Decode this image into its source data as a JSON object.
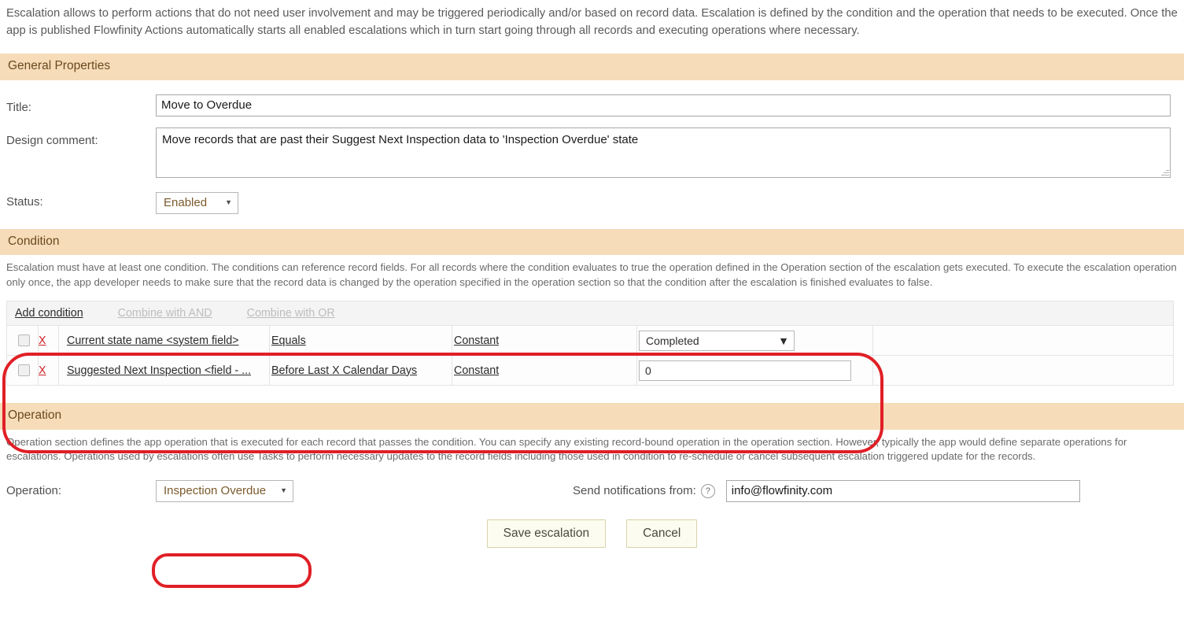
{
  "intro": {
    "text": "Escalation allows to perform actions that do not need user involvement and may be triggered periodically and/or based on record data. Escalation is defined by the condition and the operation that needs to be executed. Once the app is published Flowfinity Actions automatically starts all enabled escalations which in turn start going through all records and executing operations where necessary."
  },
  "general": {
    "header": "General Properties",
    "title_label": "Title:",
    "title_value": "Move to Overdue",
    "comment_label": "Design comment:",
    "comment_value": "Move records that are past their Suggest Next Inspection data to 'Inspection Overdue' state",
    "status_label": "Status:",
    "status_value": "Enabled"
  },
  "condition": {
    "header": "Condition",
    "description": "Escalation must have at least one condition. The conditions can reference record fields. For all records where the condition evaluates to true the operation defined in the Operation section of the escalation gets executed. To execute the escalation operation only once, the app developer needs to make sure that the record data is changed by the operation specified in the operation section so that the condition after the escalation is finished evaluates to false.",
    "toolbar": {
      "add": "Add condition",
      "and": "Combine with AND",
      "or": "Combine with OR"
    },
    "rows": [
      {
        "remove": "X",
        "field": "Current state name <system field>",
        "operator": "Equals",
        "source": "Constant",
        "value": "Completed",
        "value_type": "select"
      },
      {
        "remove": "X",
        "field": "Suggested Next Inspection <field - ...",
        "operator": "Before Last X Calendar Days",
        "source": "Constant",
        "value": "0",
        "value_type": "input"
      }
    ]
  },
  "operation": {
    "header": "Operation",
    "description": "Operation section defines the app operation that is executed for each record that passes the condition. You can specify any existing record-bound operation in the operation section. However, typically the app would define separate operations for escalations. Operations used by escalations often use Tasks to perform necessary updates to the record fields including those used in condition to re-schedule or cancel subsequent escalation triggered update for the records.",
    "operation_label": "Operation:",
    "operation_value": "Inspection Overdue",
    "notifications_label": "Send notifications from:",
    "help_glyph": "?",
    "notifications_value": "info@flowfinity.com"
  },
  "footer": {
    "save_label": "Save escalation",
    "cancel_label": "Cancel"
  },
  "colors": {
    "section_header_bg": "#f6dcb9",
    "section_header_text": "#6b4a20",
    "annotation_red": "#e01f26",
    "remove_link_red": "#cf2026",
    "button_bg": "#fdfcf0"
  },
  "icons": {
    "caret": "▼"
  }
}
